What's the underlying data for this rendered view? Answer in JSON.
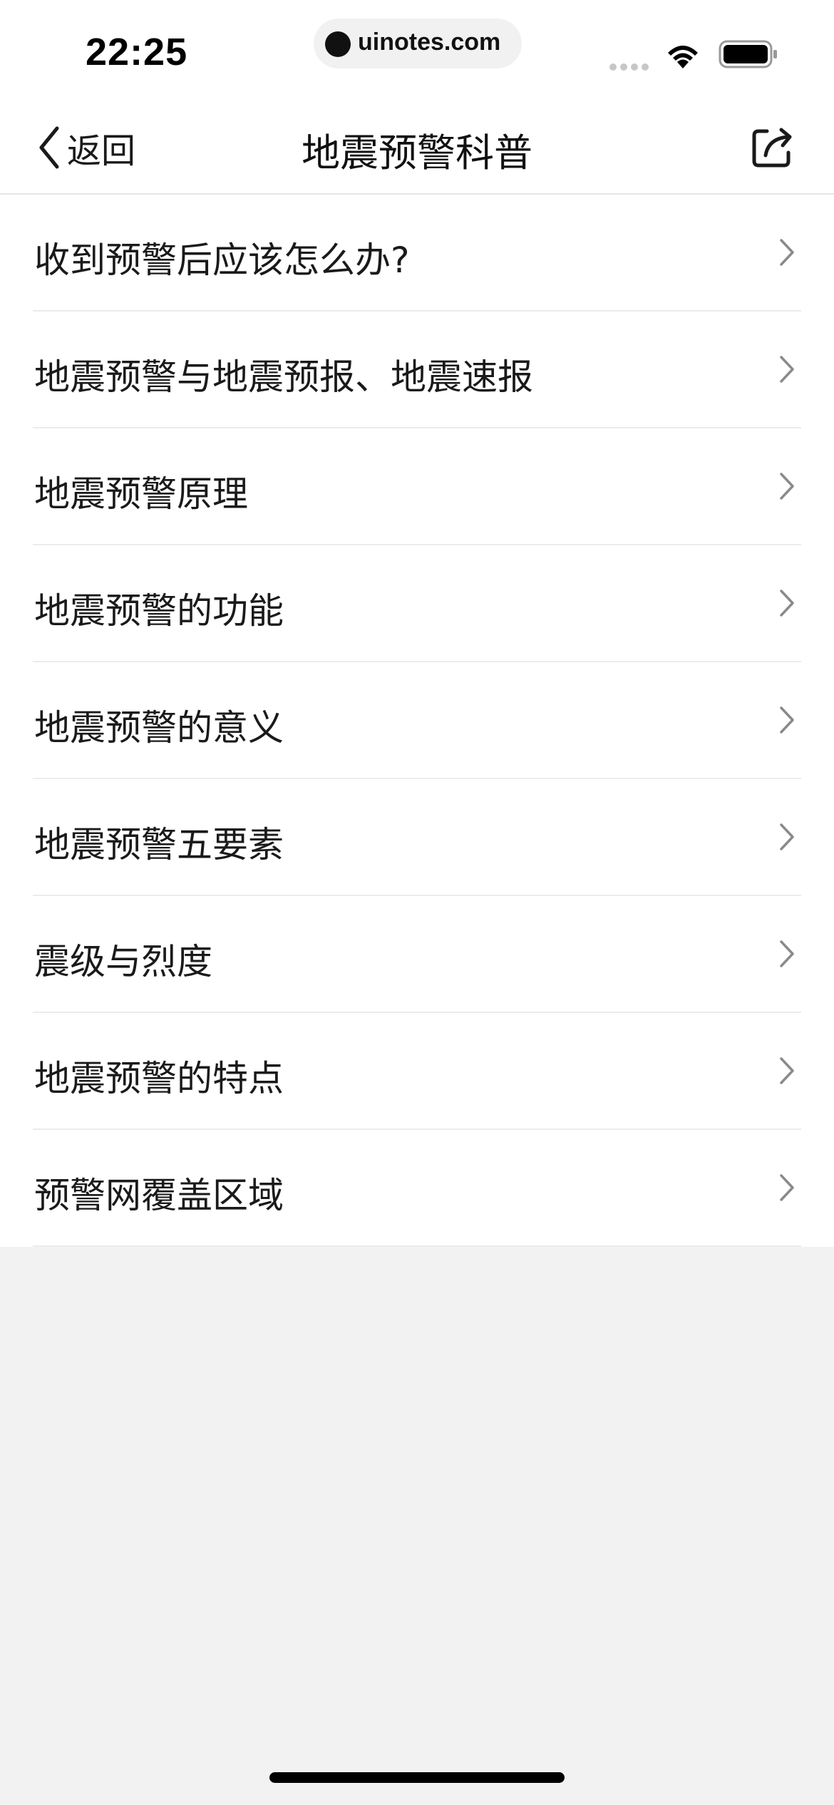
{
  "status_bar": {
    "time": "22:25",
    "url": "uinotes.com",
    "icons": [
      "signal-dots-icon",
      "wifi-icon",
      "battery-icon"
    ]
  },
  "nav": {
    "back_label": "返回",
    "title": "地震预警科普",
    "back_icon": "chevron-left-icon",
    "share_icon": "share-icon"
  },
  "list": {
    "items": [
      {
        "label": "收到预警后应该怎么办?"
      },
      {
        "label": "地震预警与地震预报、地震速报"
      },
      {
        "label": "地震预警原理"
      },
      {
        "label": "地震预警的功能"
      },
      {
        "label": "地震预警的意义"
      },
      {
        "label": "地震预警五要素"
      },
      {
        "label": "震级与烈度"
      },
      {
        "label": "地震预警的特点"
      },
      {
        "label": "预警网覆盖区域"
      }
    ]
  },
  "colors": {
    "background": "#f2f2f2",
    "surface": "#ffffff",
    "divider": "#ececec",
    "text": "#1a1a1a",
    "chevron": "#8a8a8a"
  }
}
